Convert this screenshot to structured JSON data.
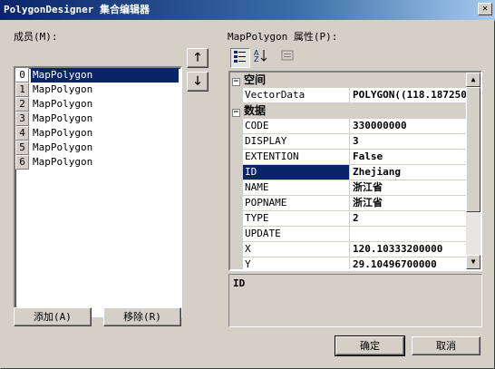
{
  "window": {
    "title": "PolygonDesigner 集合编辑器",
    "close_glyph": "✕"
  },
  "members": {
    "label": "成员(M):",
    "items": [
      {
        "index": "0",
        "name": "MapPolygon",
        "selected": true
      },
      {
        "index": "1",
        "name": "MapPolygon"
      },
      {
        "index": "2",
        "name": "MapPolygon"
      },
      {
        "index": "3",
        "name": "MapPolygon"
      },
      {
        "index": "4",
        "name": "MapPolygon"
      },
      {
        "index": "5",
        "name": "MapPolygon"
      },
      {
        "index": "6",
        "name": "MapPolygon"
      }
    ],
    "move_up_glyph": "🡑",
    "move_down_glyph": "🡓",
    "add_label": "添加(A)",
    "remove_label": "移除(R)"
  },
  "properties": {
    "label": "MapPolygon 属性(P):",
    "toolbar": {
      "categorized_icon": "categorized-icon",
      "alphabetical_icon": "alphabetical-icon",
      "pages_icon": "property-pages-icon"
    },
    "categories": [
      {
        "name": "空间",
        "toggle": "⊟",
        "rows": [
          {
            "name": "VectorData",
            "value": "POLYGON((118.187250"
          }
        ]
      },
      {
        "name": "数据",
        "toggle": "⊟",
        "rows": [
          {
            "name": "CODE",
            "value": "330000000"
          },
          {
            "name": "DISPLAY",
            "value": "3"
          },
          {
            "name": "EXTENTION",
            "value": "False"
          },
          {
            "name": "ID",
            "value": "Zhejiang",
            "selected": true
          },
          {
            "name": "NAME",
            "value": "浙江省"
          },
          {
            "name": "POPNAME",
            "value": "浙江省"
          },
          {
            "name": "TYPE",
            "value": "2"
          },
          {
            "name": "UPDATE",
            "value": ""
          },
          {
            "name": "X",
            "value": "120.10333200000"
          },
          {
            "name": "Y",
            "value": "29.10496700000"
          }
        ]
      }
    ],
    "description_title": "ID",
    "scroll_up_glyph": "▲",
    "scroll_down_glyph": "▼"
  },
  "footer": {
    "ok_label": "确定",
    "cancel_label": "取消"
  }
}
